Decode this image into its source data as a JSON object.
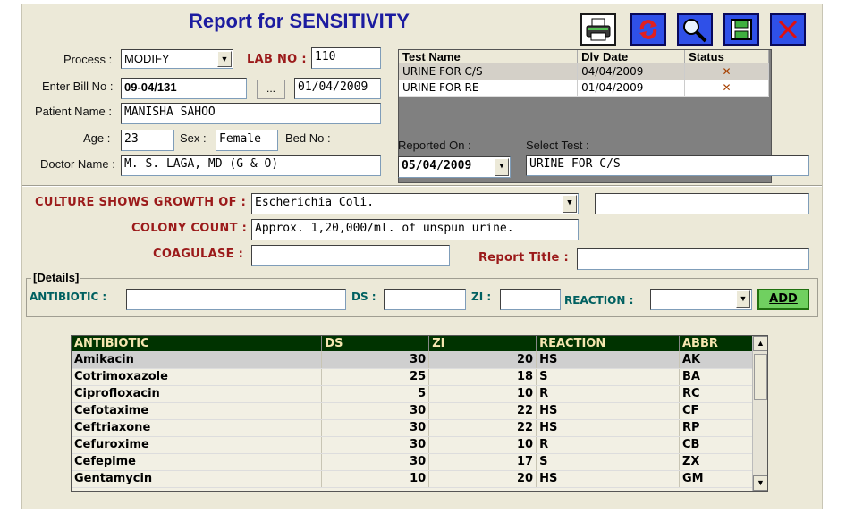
{
  "title": "Report for SENSITIVITY",
  "toolbar": {
    "print_icon": "printer-icon",
    "refresh_icon": "refresh-icon",
    "search_icon": "magnifier-icon",
    "save_icon": "floppy-icon",
    "close_icon": "close-icon"
  },
  "header": {
    "process_label": "Process :",
    "process_value": "MODIFY",
    "lab_no_label": "LAB NO :",
    "lab_no_value": "110",
    "bill_label": "Enter Bill No :",
    "bill_value": "09-04/131",
    "bill_btn": "...",
    "bill_date": "01/04/2009",
    "patient_label": "Patient Name :",
    "patient_value": "MANISHA  SAHOO",
    "age_label": "Age :",
    "age_value": "23",
    "sex_label": "Sex :",
    "sex_value": "Female",
    "bed_label": "Bed No :",
    "doctor_label": "Doctor Name :",
    "doctor_value": "M. S. LAGA, MD (G & O)"
  },
  "tests": {
    "columns": [
      "Test Name",
      "Dlv Date",
      "Status"
    ],
    "rows": [
      {
        "name": "URINE FOR C/S",
        "date": "04/04/2009",
        "status": "✕"
      },
      {
        "name": "URINE FOR RE",
        "date": "01/04/2009",
        "status": "✕"
      }
    ],
    "reported_label": "Reported On :",
    "reported_value": "05/04/2009",
    "select_label": "Select Test :",
    "select_value": "URINE FOR C/S"
  },
  "culture": {
    "growth_label": "CULTURE SHOWS GROWTH OF :",
    "growth_value": "Escherichia Coli.",
    "colony_label": "COLONY COUNT :",
    "colony_value": "Approx. 1,20,000/ml. of unspun urine.",
    "coag_label": "COAGULASE :",
    "coag_value": "",
    "report_title_label": "Report Title :",
    "report_title_value": ""
  },
  "details": {
    "group_label": "[Details]",
    "antibiotic_label": "ANTIBIOTIC :",
    "ds_label": "DS :",
    "zi_label": "ZI :",
    "reaction_label": "REACTION :",
    "add_label": "ADD"
  },
  "results": {
    "columns": [
      "ANTIBIOTIC",
      "DS",
      "ZI",
      "REACTION",
      "ABBR"
    ],
    "rows": [
      {
        "antibiotic": "Amikacin",
        "ds": "30",
        "zi": "20",
        "reaction": "HS",
        "abbr": "AK"
      },
      {
        "antibiotic": "Cotrimoxazole",
        "ds": "25",
        "zi": "18",
        "reaction": "S",
        "abbr": "BA"
      },
      {
        "antibiotic": "Ciprofloxacin",
        "ds": "5",
        "zi": "10",
        "reaction": "R",
        "abbr": "RC"
      },
      {
        "antibiotic": "Cefotaxime",
        "ds": "30",
        "zi": "22",
        "reaction": "HS",
        "abbr": "CF"
      },
      {
        "antibiotic": "Ceftriaxone",
        "ds": "30",
        "zi": "22",
        "reaction": "HS",
        "abbr": "RP"
      },
      {
        "antibiotic": "Cefuroxime",
        "ds": "30",
        "zi": "10",
        "reaction": "R",
        "abbr": "CB"
      },
      {
        "antibiotic": "Cefepime",
        "ds": "30",
        "zi": "17",
        "reaction": "S",
        "abbr": "ZX"
      },
      {
        "antibiotic": "Gentamycin",
        "ds": "10",
        "zi": "20",
        "reaction": "HS",
        "abbr": "GM"
      }
    ]
  }
}
